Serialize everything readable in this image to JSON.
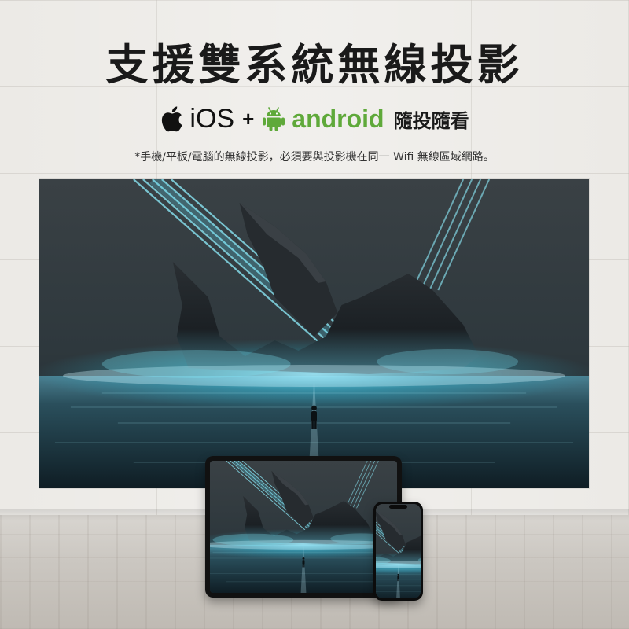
{
  "header": {
    "title": "支援雙系統無線投影",
    "ios_label": "iOS",
    "plus": "+",
    "android_label": "android",
    "watch_label": "隨投隨看",
    "note": "*手機/平板/電腦的無線投影，必須要與投影機在同一 Wifi 無線區域網路。"
  },
  "icons": {
    "apple": "apple-logo-icon",
    "android": "android-robot-icon"
  },
  "colors": {
    "title": "#1a1a1a",
    "android_green": "#5fa93a",
    "beam_cyan": "#6fe3ff",
    "glow": "#2ec8e8"
  }
}
